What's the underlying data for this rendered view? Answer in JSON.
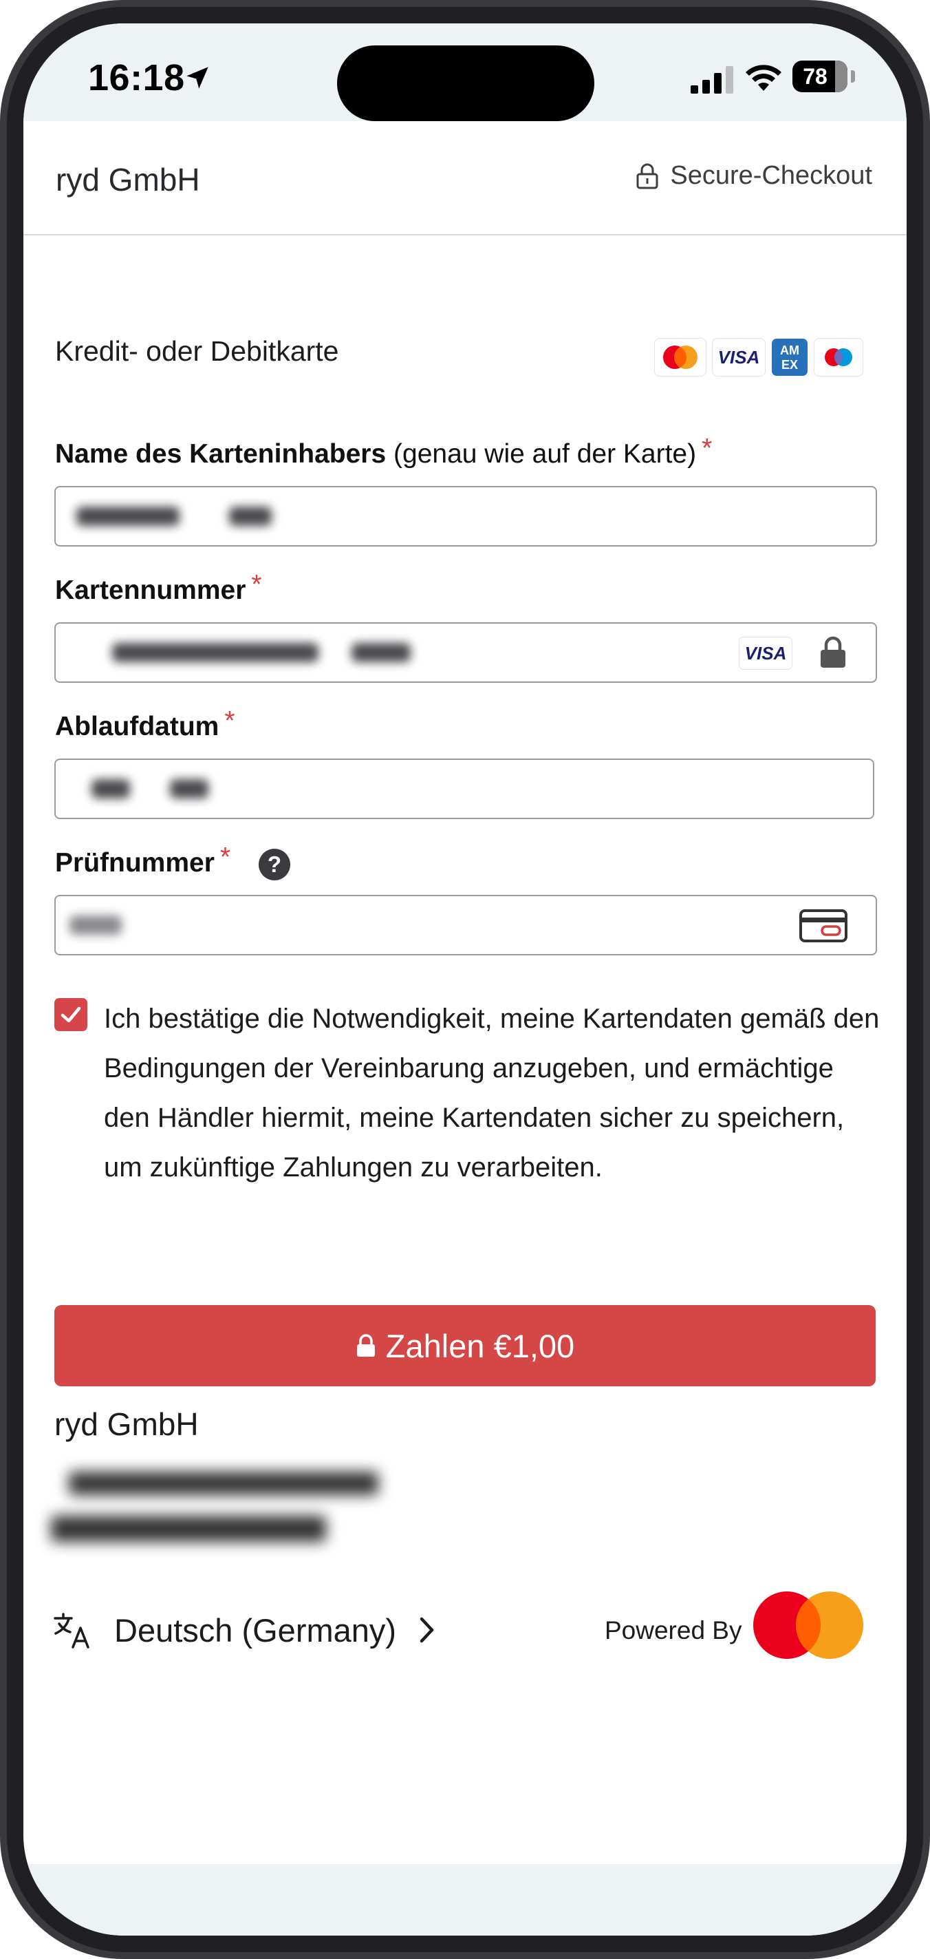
{
  "status_bar": {
    "time": "16:18",
    "battery": "78"
  },
  "header": {
    "merchant": "ryd GmbH",
    "secure_label": "Secure-Checkout"
  },
  "payment": {
    "method_label": "Kredit- oder Debitkarte",
    "brands": [
      "mastercard-logo",
      "visa-logo",
      "amex-logo",
      "maestro-logo"
    ],
    "card_brand_detected": "VISA"
  },
  "fields": {
    "cardholder": {
      "label": "Name des Karteninhabers",
      "hint": "(genau wie auf der Karte)",
      "required": "*"
    },
    "card_number": {
      "label": "Kartennummer",
      "required": "*"
    },
    "expiry": {
      "label": "Ablaufdatum",
      "required": "*"
    },
    "cvc": {
      "label": "Prüfnummer",
      "required": "*",
      "help": "?"
    }
  },
  "consent": {
    "checked": true,
    "text": "Ich bestätige die Notwendigkeit, meine Kartendaten gemäß den Bedingungen der Vereinbarung anzugeben, und ermächtige den Händler hiermit, meine Kartendaten sicher zu speichern, um zukünftige Zahlungen zu verarbeiten."
  },
  "pay_button": {
    "label": "Zahlen €1,00"
  },
  "footer": {
    "merchant": "ryd GmbH",
    "language": "Deutsch (Germany)",
    "powered_by": "Powered By"
  },
  "colors": {
    "accent": "#d54747",
    "required": "#d43f3f",
    "status_bg": "#edf2f4"
  }
}
